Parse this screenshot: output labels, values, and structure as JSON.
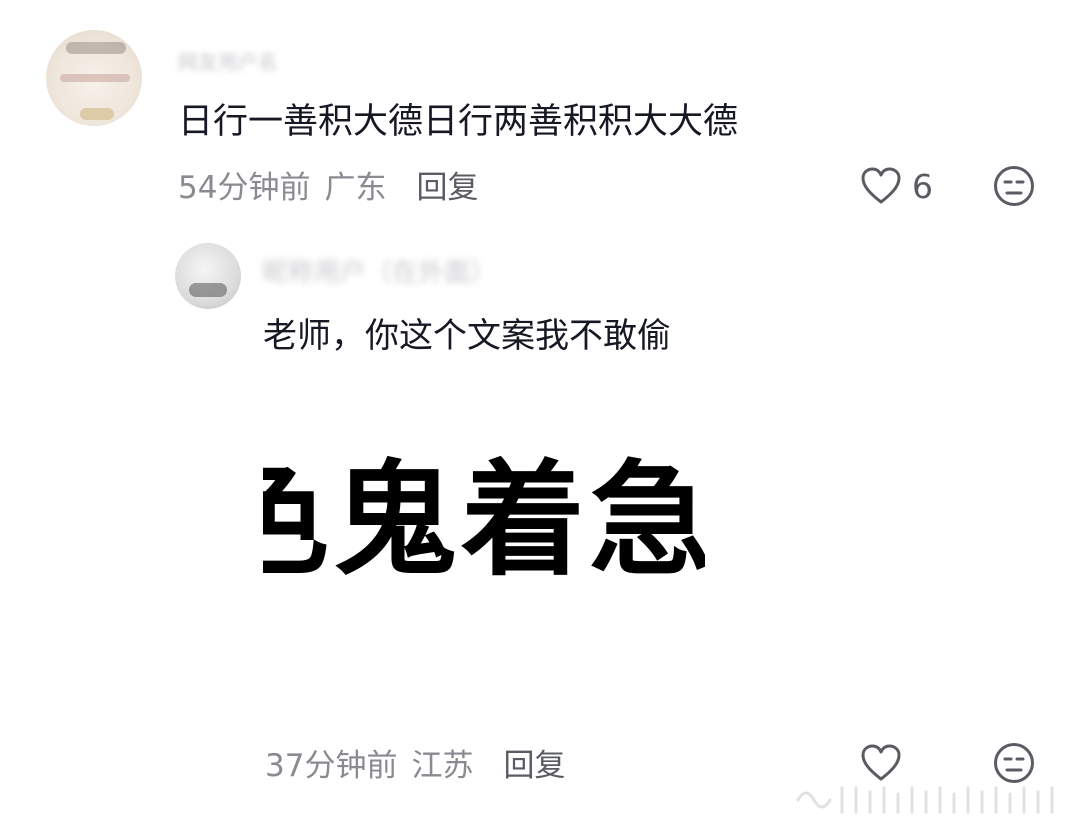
{
  "comments": [
    {
      "username": "网友用户名",
      "text": "日行一善积大德日行两善积积大大德",
      "time": "54分钟前",
      "location": "广东",
      "reply_label": "回复",
      "likes": "6",
      "replies": [
        {
          "username": "昵称用户（在外面）",
          "text": "老师，你这个文案我不敢偷",
          "sticker_text": "色鬼着急",
          "time": "37分钟前",
          "location": "江苏",
          "reply_label": "回复"
        }
      ]
    }
  ],
  "icons": {
    "like": "heart-outline-icon",
    "dislike": "meh-face-icon"
  },
  "colors": {
    "text_primary": "#161823",
    "text_secondary": "#8a8b91",
    "icon": "#5b5c63"
  }
}
